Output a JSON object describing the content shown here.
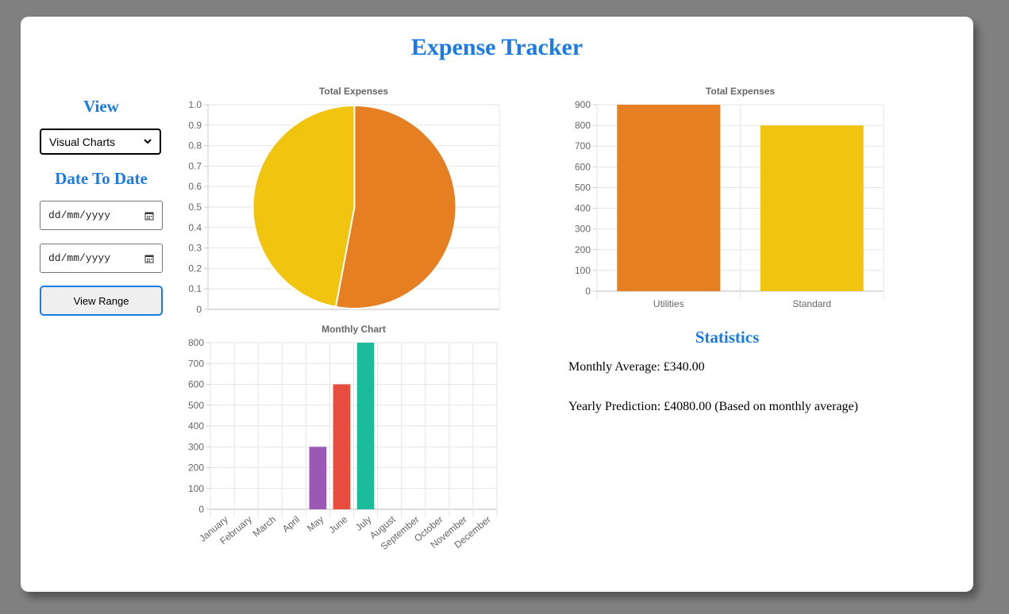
{
  "app": {
    "title": "Expense Tracker"
  },
  "sidebar": {
    "view_heading": "View",
    "view_select_value": "Visual Charts",
    "date_heading": "Date To Date",
    "start_date_placeholder": "dd/mm/yyyy",
    "end_date_placeholder": "dd/mm/yyyy",
    "range_button_label": "View Range"
  },
  "statistics": {
    "heading": "Statistics",
    "monthly_average": "Monthly Average: £340.00",
    "yearly_prediction": "Yearly Prediction: £4080.00 (Based on monthly average)"
  },
  "icons": {
    "select": "chevron-down-icon",
    "date": "calendar-icon"
  },
  "chart_data": [
    {
      "type": "pie",
      "title": "Total Expenses",
      "labels": [
        "Utilities",
        "Standard"
      ],
      "values": [
        900,
        800
      ],
      "colors": [
        "#e67e22",
        "#f1c40f"
      ],
      "ylim": [
        0,
        1
      ],
      "yticks": [
        "0",
        "0.1",
        "0.2",
        "0.3",
        "0.4",
        "0.5",
        "0.6",
        "0.7",
        "0.8",
        "0.9",
        "1.0"
      ],
      "grid": true
    },
    {
      "type": "bar",
      "title": "Total Expenses",
      "categories": [
        "Utilities",
        "Standard"
      ],
      "values": [
        900,
        800
      ],
      "colors": [
        "#e67e22",
        "#f1c40f"
      ],
      "ylim": [
        0,
        900
      ],
      "yticks": [
        0,
        100,
        200,
        300,
        400,
        500,
        600,
        700,
        800,
        900
      ],
      "grid": true
    },
    {
      "type": "bar",
      "title": "Monthly Chart",
      "categories": [
        "January",
        "February",
        "March",
        "April",
        "May",
        "June",
        "July",
        "August",
        "September",
        "October",
        "November",
        "December"
      ],
      "values": [
        0,
        0,
        0,
        0,
        300,
        600,
        800,
        0,
        0,
        0,
        0,
        0
      ],
      "colors": [
        "#9b59b6",
        "#9b59b6",
        "#9b59b6",
        "#9b59b6",
        "#9b59b6",
        "#e74c3c",
        "#1abc9c",
        "#1abc9c",
        "#1abc9c",
        "#1abc9c",
        "#1abc9c",
        "#1abc9c"
      ],
      "ylim": [
        0,
        800
      ],
      "yticks": [
        0,
        100,
        200,
        300,
        400,
        500,
        600,
        700,
        800
      ],
      "grid": true
    }
  ]
}
